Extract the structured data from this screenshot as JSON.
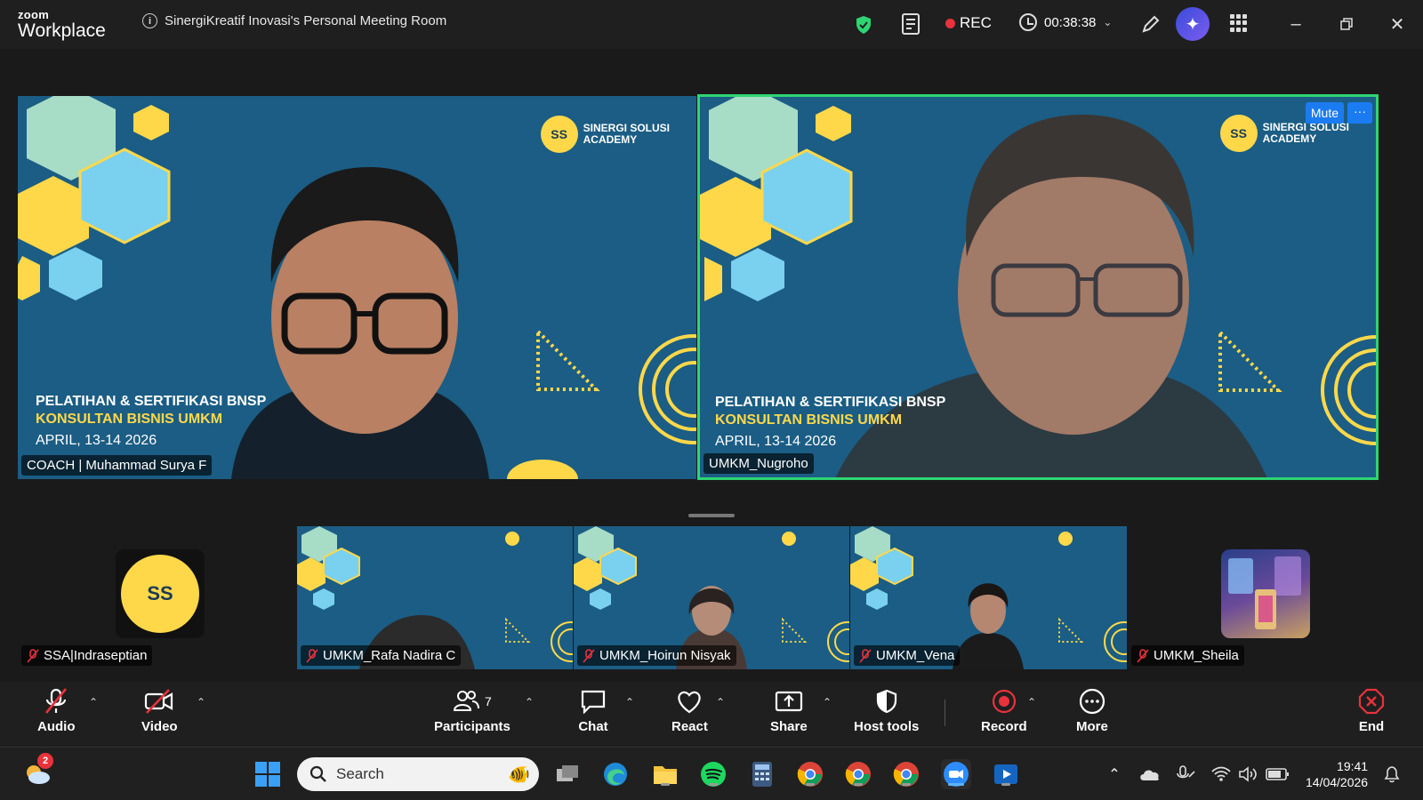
{
  "app": {
    "brand_small": "zoom",
    "brand_big": "Workplace",
    "meeting_title": "SinergiKreatif Inovasi's Personal Meeting Room",
    "rec_label": "REC",
    "timer": "00:38:38",
    "accent_color": "#2ed573",
    "rec_color": "#e8323c"
  },
  "banner": {
    "line1": "PELATIHAN & SERTIFIKASI BNSP",
    "line2": "KONSULTAN BISNIS UMKM",
    "line3": "APRIL, 13-14  2026",
    "logo_line1": "SINERGI SOLUSI",
    "logo_line2": "ACADEMY"
  },
  "main_tiles": [
    {
      "name": "COACH | Muhammad Surya F",
      "muted": false
    },
    {
      "name": "UMKM_Nugroho",
      "muted": false,
      "active": true,
      "mute_button": "Mute",
      "more_button": "···"
    }
  ],
  "strip_tiles": [
    {
      "name": "SSA|Indraseptian",
      "muted": true
    },
    {
      "name": "UMKM_Rafa Nadira C",
      "muted": true
    },
    {
      "name": "UMKM_Hoirun Nisyak",
      "muted": true
    },
    {
      "name": "UMKM_Vena",
      "muted": true
    },
    {
      "name": "UMKM_Sheila",
      "muted": true
    }
  ],
  "toolbar": {
    "audio": "Audio",
    "video": "Video",
    "participants": "Participants",
    "participants_count": "7",
    "chat": "Chat",
    "react": "React",
    "share": "Share",
    "host_tools": "Host tools",
    "record": "Record",
    "more": "More",
    "end": "End"
  },
  "taskbar": {
    "search_placeholder": "Search",
    "weather_badge": "2",
    "time": "19:41",
    "date": "14/04/2026"
  }
}
